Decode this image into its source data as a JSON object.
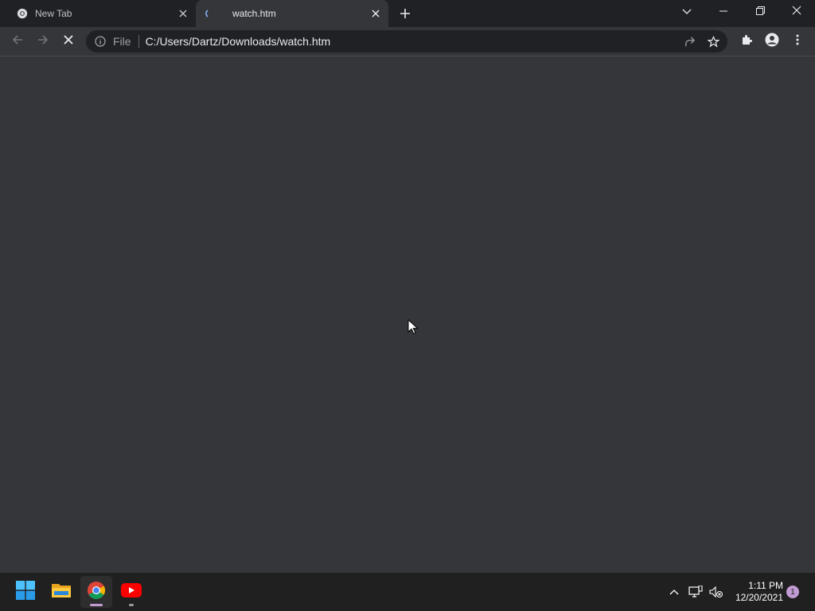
{
  "browser": {
    "tabs": [
      {
        "title": "New Tab",
        "favicon": "chrome-icon",
        "active": false
      },
      {
        "title": "watch.htm",
        "favicon": "loading-spinner-icon",
        "active": true
      }
    ],
    "new_tab_label": "+",
    "omnibox": {
      "scheme_label": "File",
      "url": "C:/Users/Dartz/Downloads/watch.htm"
    }
  },
  "taskbar": {
    "apps": [
      {
        "name": "start",
        "icon": "windows-start-icon"
      },
      {
        "name": "file-explorer",
        "icon": "folder-icon"
      },
      {
        "name": "chrome",
        "icon": "chrome-icon",
        "active": true
      },
      {
        "name": "youtube",
        "icon": "youtube-icon"
      }
    ],
    "clock": {
      "time": "1:11 PM",
      "date": "12/20/2021"
    },
    "notification_count": "1"
  },
  "colors": {
    "tabstrip_bg": "#202124",
    "page_bg": "#35363a",
    "taskbar_bg": "#202020",
    "accent_blue": "#8ab4f8"
  }
}
